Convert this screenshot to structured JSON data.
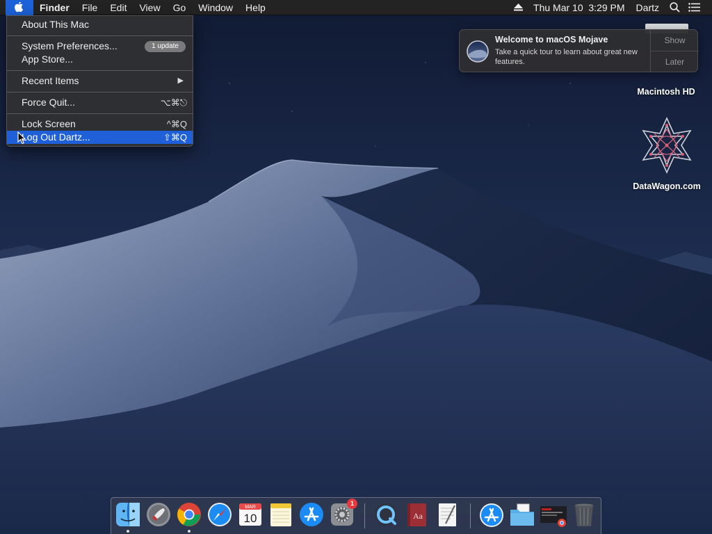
{
  "menubar": {
    "apple_icon": "apple-logo-icon",
    "app_name": "Finder",
    "menus": [
      "File",
      "Edit",
      "View",
      "Go",
      "Window",
      "Help"
    ],
    "eject_icon": "eject-icon",
    "clock": "Thu Mar 10  3:29 PM",
    "user": "Dartz",
    "spotlight_icon": "magnifier-icon",
    "notification_center_icon": "list-icon"
  },
  "apple_menu": {
    "about": "About This Mac",
    "system_preferences": "System Preferences...",
    "update_badge": "1 update",
    "app_store": "App Store...",
    "recent_items": "Recent Items",
    "force_quit": "Force Quit...",
    "force_quit_shortcut": "⌥⌘⎋",
    "lock_screen": "Lock Screen",
    "lock_screen_shortcut": "^⌘Q",
    "log_out": "Log Out Dartz...",
    "log_out_shortcut": "⇧⌘Q"
  },
  "notification": {
    "title": "Welcome to macOS Mojave",
    "body": "Take a quick tour to learn about great new features.",
    "show": "Show",
    "later": "Later"
  },
  "desktop": {
    "icons": [
      {
        "label": "Macintosh HD",
        "icon": "hard-drive-icon"
      },
      {
        "label": "DataWagon.com",
        "icon": "geometric-star-icon"
      }
    ]
  },
  "dock": {
    "apps": [
      {
        "name": "Finder",
        "icon": "finder-icon",
        "running": true
      },
      {
        "name": "Launchpad",
        "icon": "rocket-icon",
        "running": false
      },
      {
        "name": "Google Chrome",
        "icon": "chrome-icon",
        "running": true
      },
      {
        "name": "Safari",
        "icon": "compass-icon",
        "running": false
      },
      {
        "name": "Calendar",
        "icon": "calendar-icon",
        "running": false,
        "month": "MAR",
        "day": "10"
      },
      {
        "name": "Notes",
        "icon": "notes-icon",
        "running": false
      },
      {
        "name": "App Store",
        "icon": "app-store-icon",
        "running": false
      },
      {
        "name": "System Preferences",
        "icon": "gear-icon",
        "running": false,
        "badge": "1"
      },
      {
        "name": "QuickTime Player",
        "icon": "quicktime-icon",
        "running": false
      },
      {
        "name": "Dictionary",
        "icon": "dictionary-icon",
        "running": false,
        "label": "Aa"
      },
      {
        "name": "TextEdit",
        "icon": "textedit-icon",
        "running": false
      },
      {
        "name": "Applications",
        "icon": "applications-folder-icon",
        "running": false
      },
      {
        "name": "Documents",
        "icon": "folder-icon",
        "running": false
      },
      {
        "name": "Downloads",
        "icon": "downloads-stack-icon",
        "running": false
      },
      {
        "name": "Trash",
        "icon": "trash-icon",
        "running": false
      }
    ]
  },
  "colors": {
    "menu_highlight": "#1f5fd7",
    "menubar_bg": "#232323",
    "sky_top": "#13203b",
    "dune_light": "#8f9fbc"
  }
}
